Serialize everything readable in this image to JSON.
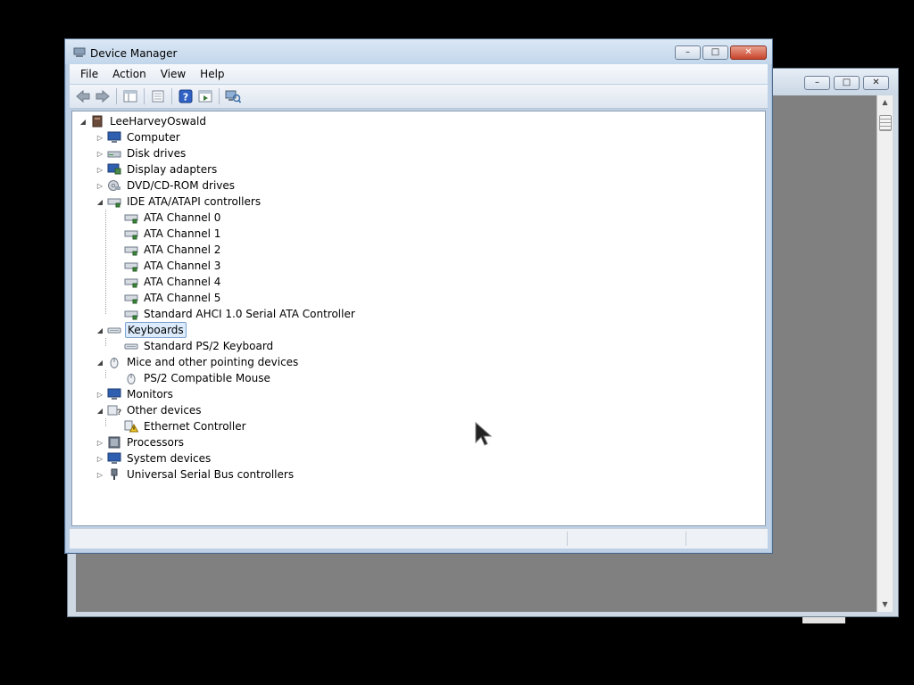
{
  "background_window": {
    "scroll_up_glyph": "▲",
    "scroll_down_glyph": "▼"
  },
  "window": {
    "title": "Device Manager",
    "controls": {
      "minimize": "–",
      "maximize": "□",
      "close": "✕"
    }
  },
  "menu": [
    "File",
    "Action",
    "View",
    "Help"
  ],
  "toolbar": [
    "back-icon",
    "forward-icon",
    "show-hide-tree-icon",
    "properties-icon",
    "help-icon",
    "show-hidden-icon",
    "scan-hardware-icon"
  ],
  "tree": [
    {
      "label": "LeeHarveyOswald",
      "level": 0,
      "expander": "◢",
      "icon": "computer-root-icon"
    },
    {
      "label": "Computer",
      "level": 1,
      "expander": "▷",
      "icon": "monitor-icon"
    },
    {
      "label": "Disk drives",
      "level": 1,
      "expander": "▷",
      "icon": "disk-drive-icon"
    },
    {
      "label": "Display adapters",
      "level": 1,
      "expander": "▷",
      "icon": "display-adapter-icon"
    },
    {
      "label": "DVD/CD-ROM drives",
      "level": 1,
      "expander": "▷",
      "icon": "dvd-drive-icon"
    },
    {
      "label": "IDE ATA/ATAPI controllers",
      "level": 1,
      "expander": "◢",
      "icon": "ide-controller-icon"
    },
    {
      "label": "ATA Channel 0",
      "level": 2,
      "expander": "",
      "icon": "ide-controller-icon"
    },
    {
      "label": "ATA Channel 1",
      "level": 2,
      "expander": "",
      "icon": "ide-controller-icon"
    },
    {
      "label": "ATA Channel 2",
      "level": 2,
      "expander": "",
      "icon": "ide-controller-icon"
    },
    {
      "label": "ATA Channel 3",
      "level": 2,
      "expander": "",
      "icon": "ide-controller-icon"
    },
    {
      "label": "ATA Channel 4",
      "level": 2,
      "expander": "",
      "icon": "ide-controller-icon"
    },
    {
      "label": "ATA Channel 5",
      "level": 2,
      "expander": "",
      "icon": "ide-controller-icon"
    },
    {
      "label": "Standard AHCI 1.0 Serial ATA Controller",
      "level": 2,
      "expander": "",
      "icon": "ide-controller-icon"
    },
    {
      "label": "Keyboards",
      "level": 1,
      "expander": "◢",
      "icon": "keyboard-icon",
      "selected": true
    },
    {
      "label": "Standard PS/2 Keyboard",
      "level": 2,
      "expander": "",
      "icon": "keyboard-icon"
    },
    {
      "label": "Mice and other pointing devices",
      "level": 1,
      "expander": "◢",
      "icon": "mouse-icon"
    },
    {
      "label": "PS/2 Compatible Mouse",
      "level": 2,
      "expander": "",
      "icon": "mouse-icon"
    },
    {
      "label": "Monitors",
      "level": 1,
      "expander": "▷",
      "icon": "monitor-icon"
    },
    {
      "label": "Other devices",
      "level": 1,
      "expander": "◢",
      "icon": "unknown-device-icon"
    },
    {
      "label": "Ethernet Controller",
      "level": 2,
      "expander": "",
      "icon": "warning-device-icon"
    },
    {
      "label": "Processors",
      "level": 1,
      "expander": "▷",
      "icon": "processor-icon"
    },
    {
      "label": "System devices",
      "level": 1,
      "expander": "▷",
      "icon": "monitor-icon"
    },
    {
      "label": "Universal Serial Bus controllers",
      "level": 1,
      "expander": "▷",
      "icon": "usb-icon"
    }
  ]
}
